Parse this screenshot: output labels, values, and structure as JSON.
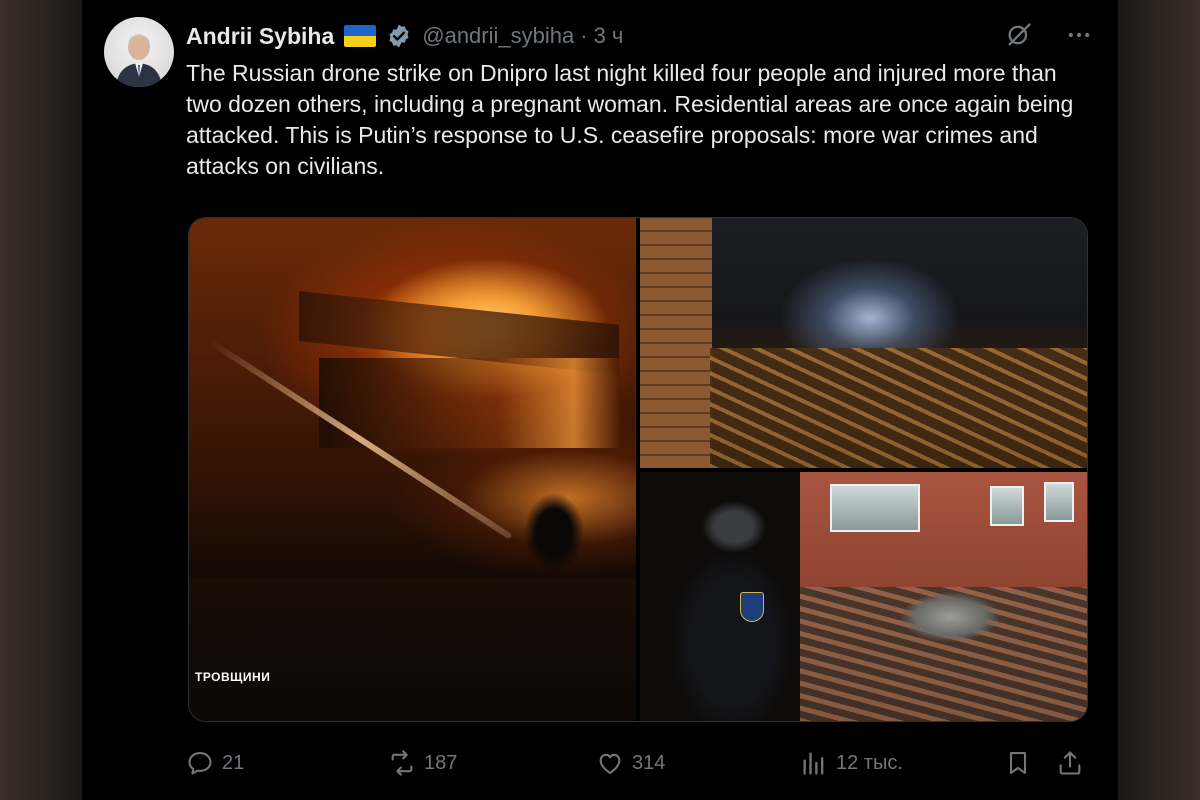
{
  "author": {
    "name": "Andrii Sybiha",
    "handle": "@andrii_sybiha",
    "separator": "·",
    "time": "3 ч",
    "flag_colors": [
      "#1f64c8",
      "#f6cf1c"
    ],
    "verified_color": "#829aab"
  },
  "tweet": {
    "text": "The Russian drone strike on Dnipro last night killed four people and injured more than two dozen others, including a pregnant woman. Residential areas are once again being attacked. This is Putin’s response to U.S. ceasefire proposals: more war crimes and attacks on civilians."
  },
  "media": {
    "photo1_caption": "ТРОВЩИНИ"
  },
  "actions": {
    "replies": "21",
    "reposts": "187",
    "likes": "314",
    "views": "12 тыс."
  },
  "icons": {
    "grok": "grok-icon",
    "more": "more-icon",
    "reply": "reply-icon",
    "repost": "repost-icon",
    "like": "heart-icon",
    "views": "views-icon",
    "bookmark": "bookmark-icon",
    "share": "share-icon"
  }
}
